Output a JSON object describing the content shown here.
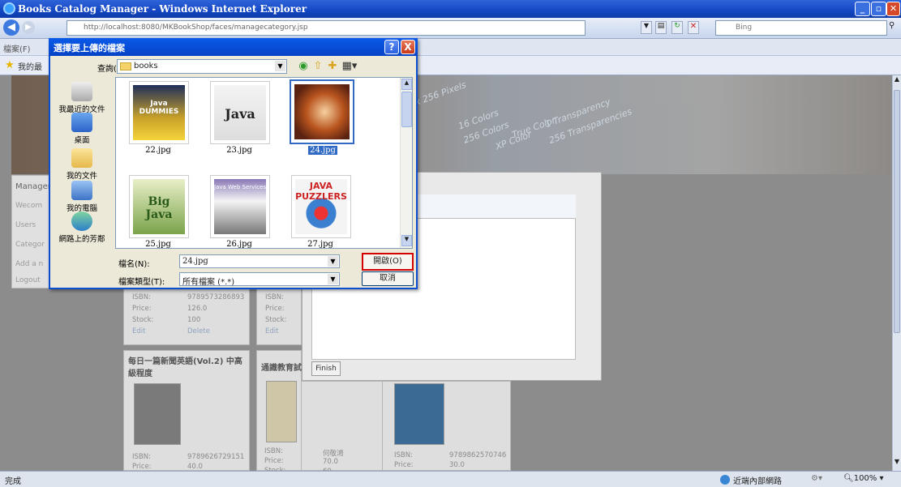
{
  "window": {
    "title": "Books Catalog Manager - Windows Internet Explorer"
  },
  "address": {
    "url": "http://localhost:8080/MKBookShop/faces/managecategory.jsp",
    "search_placeholder": "Bing"
  },
  "menubar": {
    "first_item": "檔案(F)"
  },
  "favorites": {
    "label": "我的最"
  },
  "leftnav": {
    "title": "Manager",
    "items": [
      "Wecom",
      "Users",
      "Categor",
      "Add a n",
      "Logout"
    ]
  },
  "cards": [
    {
      "isbn_label": "ISBN:",
      "isbn": "9789573286893",
      "price_label": "Price:",
      "price": "126.0",
      "stock_label": "Stock:",
      "stock": "100",
      "edit": "Edit",
      "delete": "Delete"
    },
    {
      "isbn_label": "ISBN:",
      "price_label": "Price:",
      "stock_label": "Stock:",
      "edit": "Edit"
    },
    {
      "title": "每日一篇新聞英語(Vol.2) 中高級程度",
      "isbn_label": "ISBN:",
      "isbn": "9789626729151",
      "price_label": "Price:",
      "price": "40.0"
    },
    {
      "title": "通識教育試",
      "isbn_label": "ISBN:",
      "isbn": "何敬鴻",
      "price_label": "Price:",
      "price": "70.0",
      "stock_label": "Stock:",
      "stock": "60"
    },
    {
      "isbn_label": "ISBN:",
      "isbn": "9789862570746",
      "price_label": "Price:",
      "price": "30.0"
    }
  ],
  "finish_label": "Finish",
  "dialog": {
    "title": "選擇要上傳的檔案",
    "help": "?",
    "close": "X",
    "lookin_label": "查詢(I):",
    "lookin_value": "books",
    "places": [
      "我最近的文件",
      "桌面",
      "我的文件",
      "我的電腦",
      "網路上的芳鄰"
    ],
    "files": [
      "22.jpg",
      "23.jpg",
      "24.jpg",
      "25.jpg",
      "26.jpg",
      "27.jpg"
    ],
    "thumb_titles": [
      "Java DUMMIES",
      "Java",
      "",
      "Big Java",
      "Java Web Services",
      "JAVA PUZZLERS"
    ],
    "selected_file": "24.jpg",
    "filename_label": "檔名(N):",
    "filename_value": "24.jpg",
    "filetype_label": "檔案類型(T):",
    "filetype_value": "所有檔案 (*.*)",
    "open_label": "開啟(O)",
    "cancel_label": "取消"
  },
  "banner_texts": [
    "16 Colors",
    "256 Colors",
    "True Color",
    "XP Color",
    "1 Transparency",
    "256 Transparencies",
    "x 256 Pixels"
  ],
  "status": {
    "left": "完成",
    "zone": "近端內部網路",
    "zoom": "100%"
  }
}
